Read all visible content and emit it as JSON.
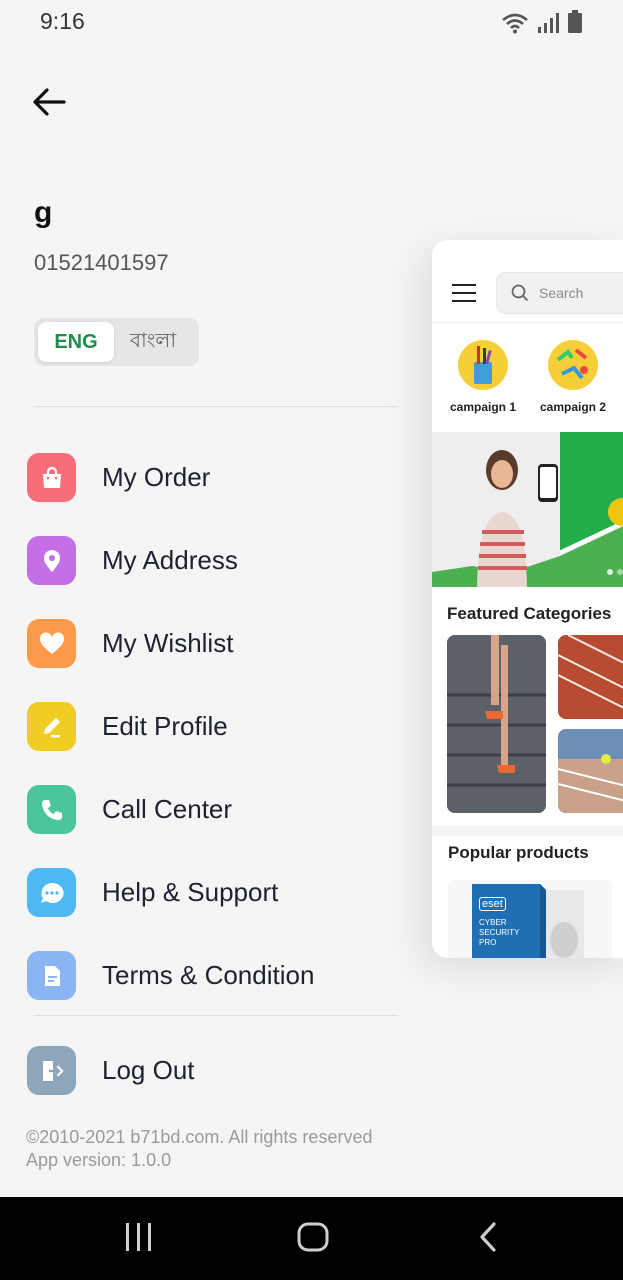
{
  "status_bar": {
    "time": "9:16"
  },
  "profile": {
    "name": "g",
    "phone": "01521401597"
  },
  "language": {
    "options": [
      "ENG",
      "বাংলা"
    ],
    "selected": "ENG"
  },
  "menu": [
    {
      "label": "My Order",
      "icon": "shopping-bag-icon",
      "color": "#f76d7a"
    },
    {
      "label": "My Address",
      "icon": "location-pin-icon",
      "color": "#c46ee8"
    },
    {
      "label": "My Wishlist",
      "icon": "heart-icon",
      "color": "#ff9a4a"
    },
    {
      "label": "Edit Profile",
      "icon": "pencil-icon",
      "color": "#f1cc24"
    },
    {
      "label": "Call Center",
      "icon": "phone-icon",
      "color": "#4bc69a"
    },
    {
      "label": "Help & Support",
      "icon": "chat-bubble-icon",
      "color": "#4cb8f4"
    },
    {
      "label": "Terms & Condition",
      "icon": "document-icon",
      "color": "#8ab4f2"
    }
  ],
  "logout": {
    "label": "Log Out",
    "icon": "logout-icon",
    "color": "#8ea6ba"
  },
  "footer": {
    "copyright": "©2010-2021 b71bd.com. All rights reserved",
    "version": "App version: 1.0.0"
  },
  "preview": {
    "search_placeholder": "Search",
    "campaigns": [
      "campaign 1",
      "campaign 2"
    ],
    "featured_title": "Featured Categories",
    "popular_title": "Popular products",
    "product_box_text": [
      "eset",
      "CYBER",
      "SECURITY",
      "PRO"
    ]
  }
}
